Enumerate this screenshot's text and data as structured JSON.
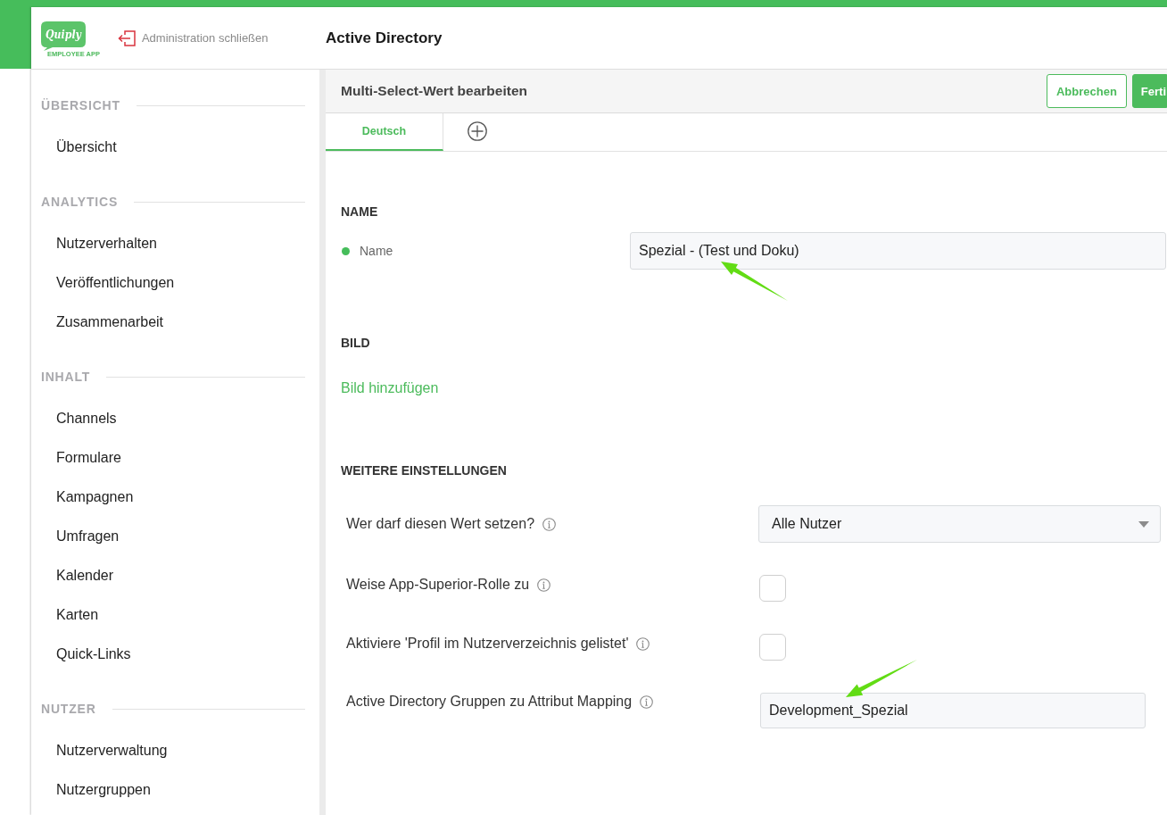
{
  "header": {
    "logo": {
      "wordmark": "Quiply",
      "tagline": "EMPLOYEE APP"
    },
    "close_link": "Administration schließen",
    "title": "Active Directory"
  },
  "sidebar": {
    "sections": [
      {
        "heading": "ÜBERSICHT",
        "items": [
          {
            "label": "Übersicht",
            "selected": false
          }
        ]
      },
      {
        "heading": "ANALYTICS",
        "items": [
          {
            "label": "Nutzerverhalten",
            "selected": false
          },
          {
            "label": "Veröffentlichungen",
            "selected": false
          },
          {
            "label": "Zusammenarbeit",
            "selected": false
          }
        ]
      },
      {
        "heading": "INHALT",
        "items": [
          {
            "label": "Channels",
            "selected": false
          },
          {
            "label": "Formulare",
            "selected": false
          },
          {
            "label": "Kampagnen",
            "selected": false
          },
          {
            "label": "Umfragen",
            "selected": false
          },
          {
            "label": "Kalender",
            "selected": false
          },
          {
            "label": "Karten",
            "selected": false
          },
          {
            "label": "Quick-Links",
            "selected": false
          }
        ]
      },
      {
        "heading": "NUTZER",
        "items": [
          {
            "label": "Nutzerverwaltung",
            "selected": false
          },
          {
            "label": "Nutzergruppen",
            "selected": false
          }
        ]
      }
    ]
  },
  "editor": {
    "title": "Multi-Select-Wert bearbeiten",
    "buttons": [
      {
        "kind": "secondary",
        "label": "Abbrechen"
      },
      {
        "kind": "primary",
        "label": "Ferti"
      }
    ],
    "tabs": [
      {
        "kind": "language",
        "label": "Deutsch",
        "selected": true
      },
      {
        "kind": "add",
        "selected": false
      }
    ],
    "sections": [
      {
        "heading": "NAME",
        "kind": "main",
        "fields": [
          {
            "kind": "text",
            "label": "Name",
            "dot": true,
            "value": "Spezial - (Test und Doku)"
          }
        ]
      },
      {
        "heading": "BILD",
        "kind": "main",
        "fields": [
          {
            "kind": "link",
            "label": "Bild hinzufügen"
          }
        ]
      },
      {
        "heading": "WEITERE EINSTELLUNGEN",
        "kind": "settings",
        "fields": [
          {
            "kind": "select",
            "label": "Wer darf diesen Wert setzen?",
            "info": true,
            "value": "Alle Nutzer"
          },
          {
            "kind": "checkbox",
            "label": "Weise App-Superior-Rolle zu",
            "info": true,
            "checked": false
          },
          {
            "kind": "checkbox",
            "label": "Aktiviere 'Profil im Nutzerverzeichnis gelistet'",
            "info": true,
            "checked": false
          },
          {
            "kind": "text",
            "label": "Active Directory Gruppen zu Attribut Mapping",
            "info": true,
            "value": "Development_Spezial"
          }
        ]
      }
    ]
  }
}
